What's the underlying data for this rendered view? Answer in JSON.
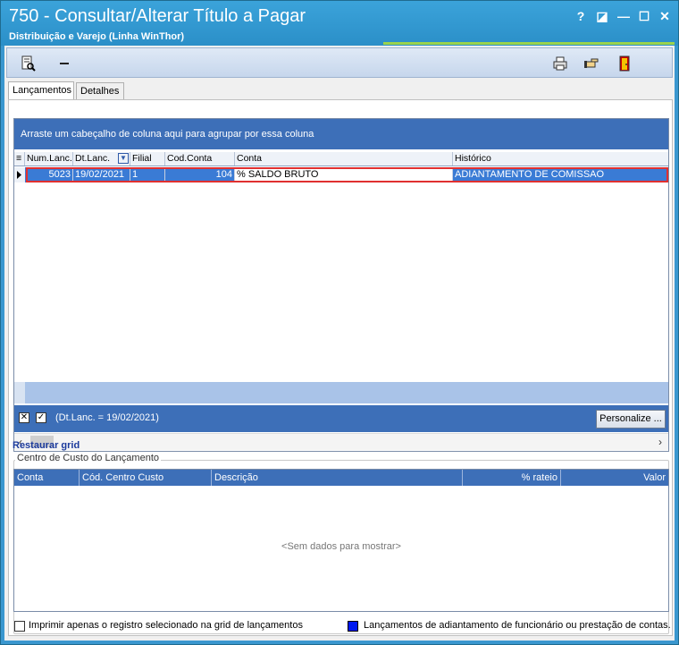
{
  "window": {
    "title": "750 - Consultar/Alterar Título a Pagar",
    "subtitle": "Distribuição e Varejo (Linha WinThor)",
    "controls": [
      "?",
      "◪",
      "—",
      "☐",
      "✕"
    ]
  },
  "toolbar": {
    "icons": [
      "document-search-icon",
      "minus-icon",
      "printer-icon",
      "hand-pointer-icon",
      "exit-door-icon"
    ]
  },
  "tabs": [
    {
      "label": "Lançamentos",
      "active": true
    },
    {
      "label": "Detalhes",
      "active": false
    }
  ],
  "grid": {
    "group_hint": "Arraste um cabeçalho de coluna aqui para agrupar por essa coluna",
    "columns": [
      "Num.Lanc.",
      "Dt.Lanc.",
      "Filial",
      "Cod.Conta",
      "Conta",
      "Histórico"
    ],
    "rows": [
      {
        "num_lanc": "5023",
        "dt_lanc": "19/02/2021",
        "filial": "1",
        "cod_conta": "104",
        "conta": "% SALDO BRUTO",
        "historico": "ADIANTAMENTO DE COMISSAO"
      }
    ],
    "filter_text": "(Dt.Lanc. = 19/02/2021)",
    "personalize_label": "Personalize ...",
    "restore_label": "Restaurar grid"
  },
  "cost_center": {
    "legend": "Centro de Custo do Lançamento",
    "columns": [
      "Conta",
      "Cód. Centro Custo",
      "Descrição",
      "% rateio",
      "Valor"
    ],
    "empty_text": "<Sem dados para mostrar>"
  },
  "footer": {
    "print_selected_label": "Imprimir apenas o registro selecionado na grid de lançamentos",
    "legend_label": "Lançamentos de adiantamento de funcionário ou prestação de contas.",
    "legend_color": "#0018f0"
  }
}
